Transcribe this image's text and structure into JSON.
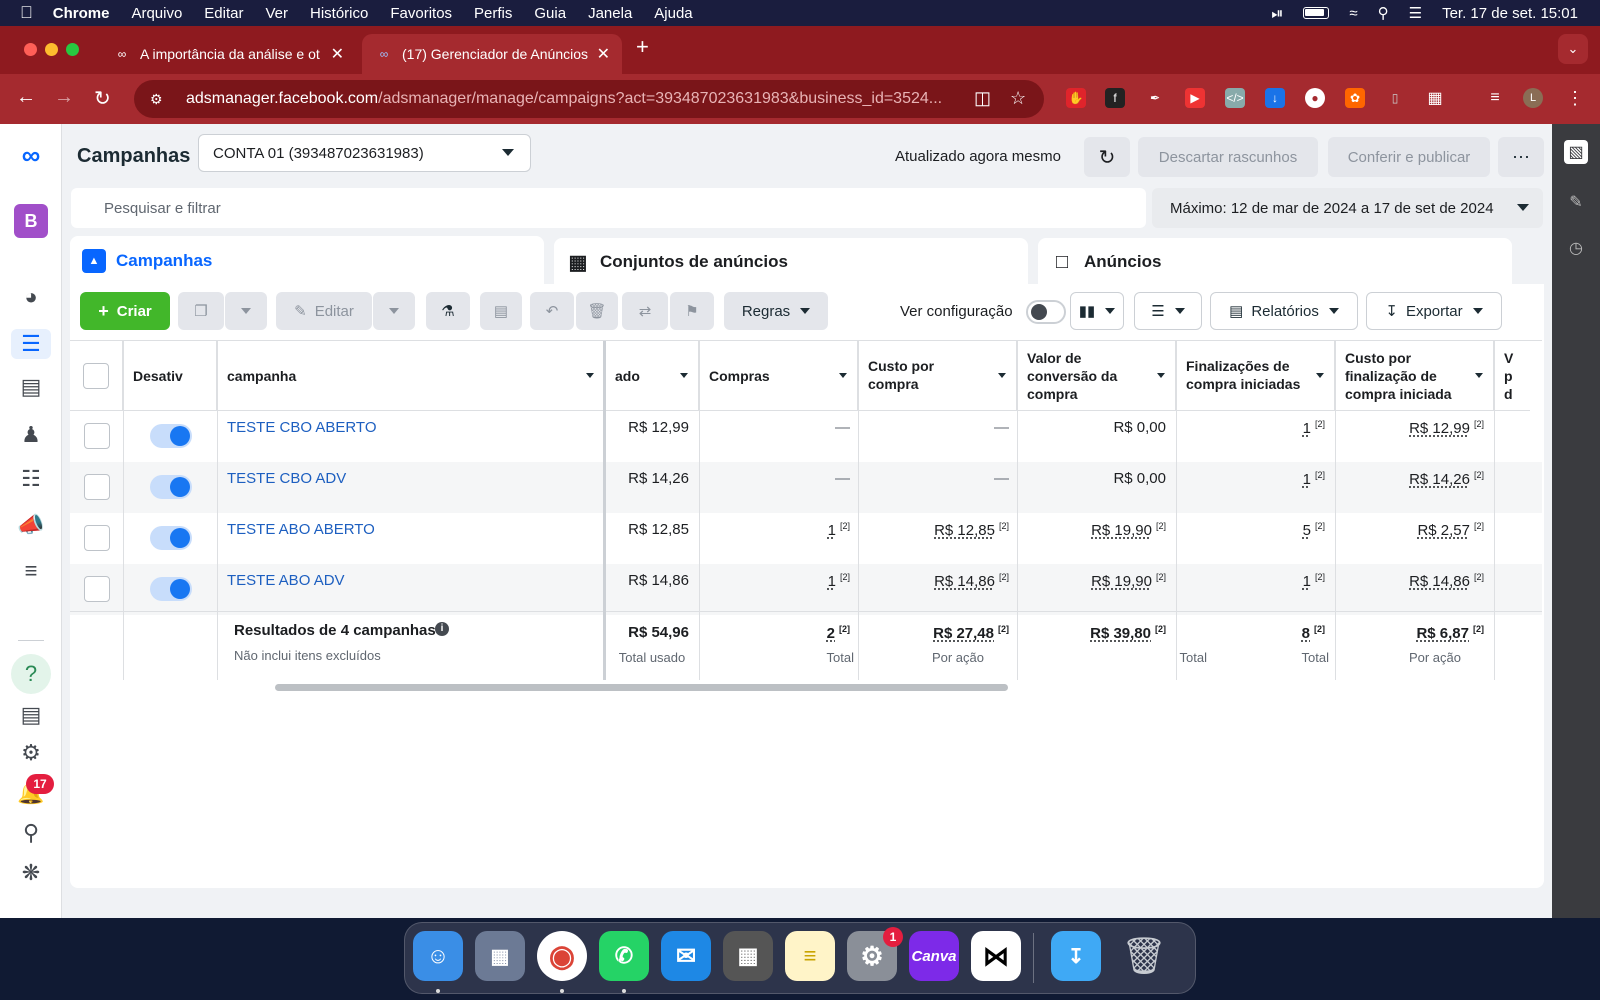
{
  "os_menubar": {
    "app_name": "Chrome",
    "menus": [
      "Arquivo",
      "Editar",
      "Ver",
      "Histórico",
      "Favoritos",
      "Perfis",
      "Guia",
      "Janela",
      "Ajuda"
    ],
    "datetime": "Ter. 17 de set.  15:01"
  },
  "browser": {
    "tabs": [
      {
        "title": "A importância da análise e ot"
      },
      {
        "title": "(17) Gerenciador de Anúncios"
      }
    ],
    "url_host": "adsmanager.facebook.com",
    "url_path": "/adsmanager/manage/campaigns?act=393487023631983&business_id=3524...",
    "profile_initial": "L"
  },
  "leftnav": {
    "business_initial": "B",
    "notifications_count": "17"
  },
  "header": {
    "title": "Campanhas",
    "account": "CONTA 01 (393487023631983)",
    "updated": "Atualizado agora mesmo",
    "discard_label": "Descartar rascunhos",
    "publish_label": "Conferir e publicar"
  },
  "search": {
    "placeholder": "Pesquisar e filtrar"
  },
  "date_range": "Máximo: 12 de mar de 2024 a 17 de set de 2024",
  "level_tabs": {
    "campaigns": "Campanhas",
    "adsets": "Conjuntos de anúncios",
    "ads": "Anúncios"
  },
  "toolbar": {
    "create": "Criar",
    "edit": "Editar",
    "rules": "Regras",
    "view_config": "Ver configuração",
    "reports": "Relatórios",
    "export": "Exportar"
  },
  "table": {
    "headers": {
      "toggle": "Desativ",
      "campaign": "campanha",
      "spent": "ado",
      "purchases": "Compras",
      "cost_per_purchase": "Custo por compra",
      "conversion_value": "Valor de conversão da compra",
      "checkouts": "Finalizações de compra iniciadas",
      "cost_per_checkout": "Custo por finalização de compra iniciada",
      "next": "V p d"
    },
    "rows": [
      {
        "name": "TESTE CBO ABERTO",
        "spent": "R$ 12,99",
        "purchases": "—",
        "cpp": "—",
        "value": "R$ 0,00",
        "checkouts": "1",
        "cpc": "R$ 12,99",
        "active": true
      },
      {
        "name": "TESTE CBO ADV",
        "spent": "R$ 14,26",
        "purchases": "—",
        "cpp": "—",
        "value": "R$ 0,00",
        "checkouts": "1",
        "cpc": "R$ 14,26",
        "active": true
      },
      {
        "name": "TESTE ABO ABERTO",
        "spent": "R$ 12,85",
        "purchases": "1",
        "cpp": "R$ 12,85",
        "value": "R$ 19,90",
        "checkouts": "5",
        "cpc": "R$ 2,57",
        "active": true
      },
      {
        "name": "TESTE ABO ADV",
        "spent": "R$ 14,86",
        "purchases": "1",
        "cpp": "R$ 14,86",
        "value": "R$ 19,90",
        "checkouts": "1",
        "cpc": "R$ 14,86",
        "active": true
      }
    ],
    "footnote": "[2]",
    "totals": {
      "title": "Resultados de 4 campanhas",
      "subtitle": "Não inclui itens excluídos",
      "spent": "R$ 54,96",
      "spent_label": "Total usado",
      "purchases": "2",
      "purchases_label": "Total",
      "cpp": "R$ 27,48",
      "cpp_label": "Por ação",
      "value": "R$ 39,80",
      "value_label": "Total",
      "checkouts": "8",
      "checkouts_label": "Total",
      "cpc": "R$ 6,87",
      "cpc_label": "Por ação"
    }
  },
  "dock": {
    "canva_label": "Canva",
    "settings_badge": "1"
  }
}
